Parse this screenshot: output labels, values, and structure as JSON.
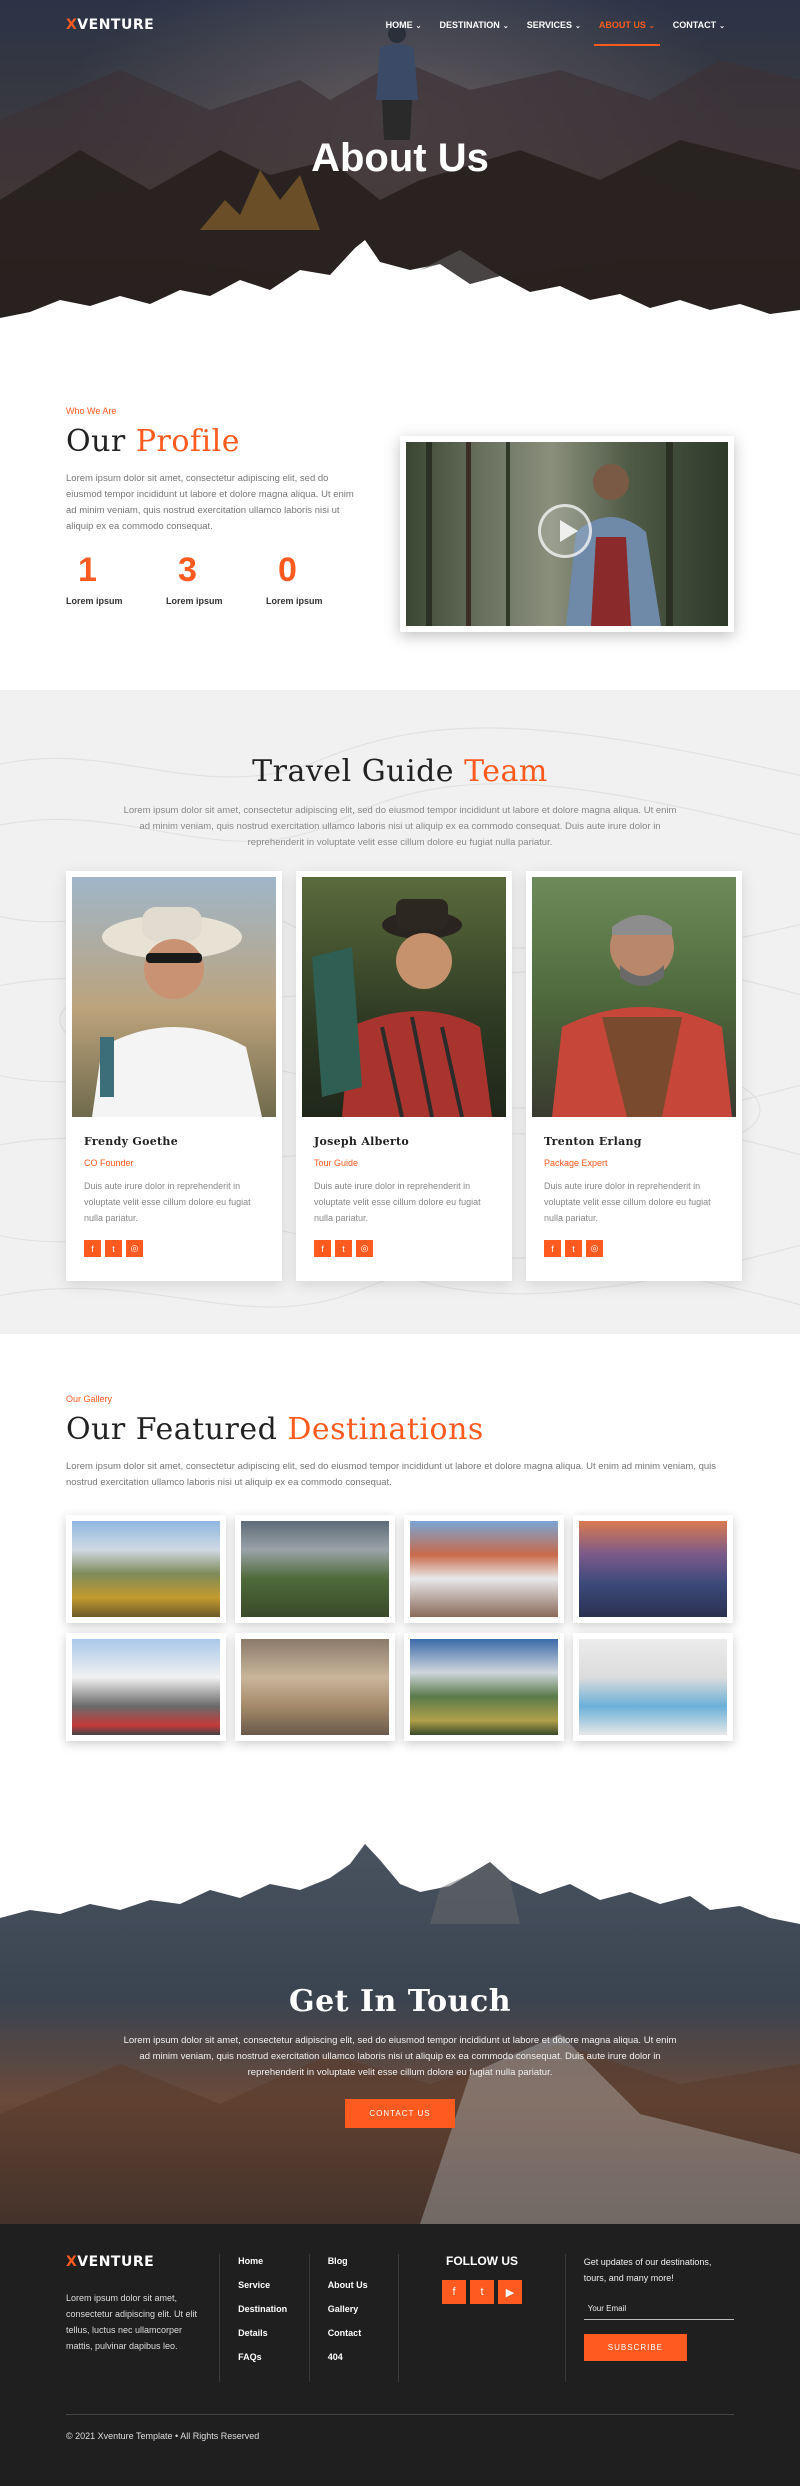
{
  "brand": {
    "logo_x": "X",
    "logo_rest": "VENTURE"
  },
  "nav": {
    "items": [
      {
        "label": "HOME"
      },
      {
        "label": "DESTINATION"
      },
      {
        "label": "SERVICES"
      },
      {
        "label": "ABOUT US",
        "active": true
      },
      {
        "label": "CONTACT"
      }
    ],
    "chevron": "⌄"
  },
  "hero": {
    "title": "About Us"
  },
  "profile": {
    "eyebrow": "Who We Are",
    "title_a": "Our",
    "title_b": "Profile",
    "text": "Lorem ipsum dolor sit amet, consectetur adipiscing elit, sed do eiusmod tempor incididunt ut labore et dolore magna aliqua. Ut enim ad minim veniam, quis nostrud exercitation ullamco laboris nisi ut aliquip ex ea commodo consequat.",
    "counters": [
      {
        "num": "1",
        "label": "Lorem ipsum"
      },
      {
        "num": "3",
        "label": "Lorem ipsum"
      },
      {
        "num": "0",
        "label": "Lorem ipsum"
      }
    ]
  },
  "team": {
    "title_a": "Travel Guide",
    "title_b": "Team",
    "text": "Lorem ipsum dolor sit amet, consectetur adipiscing elit, sed do eiusmod tempor incididunt ut labore et dolore magna aliqua. Ut enim ad minim veniam, quis nostrud exercitation ullamco laboris nisi ut aliquip ex ea commodo consequat. Duis aute irure dolor in reprehenderit in voluptate velit esse cillum dolore eu fugiat nulla pariatur.",
    "members": [
      {
        "name": "Frendy Goethe",
        "role": "CO Founder",
        "desc": "Duis aute irure dolor in reprehenderit in voluptate velit esse cillum dolore eu fugiat nulla pariatur."
      },
      {
        "name": "Joseph Alberto",
        "role": "Tour Guide",
        "desc": "Duis aute irure dolor in reprehenderit in voluptate velit esse cillum dolore eu fugiat nulla pariatur."
      },
      {
        "name": "Trenton Erlang",
        "role": "Package Expert",
        "desc": "Duis aute irure dolor in reprehenderit in voluptate velit esse cillum dolore eu fugiat nulla pariatur."
      }
    ]
  },
  "gallery": {
    "eyebrow": "Our Gallery",
    "title_a": "Our Featured",
    "title_b": "Destinations",
    "text": "Lorem ipsum dolor sit amet, consectetur adipiscing elit, sed do eiusmod tempor incididunt ut labore et dolore magna aliqua. Ut enim ad minim veniam, quis nostrud exercitation ullamco laboris nisi ut aliquip ex ea commodo consequat."
  },
  "cta": {
    "title": "Get In Touch",
    "text": "Lorem ipsum dolor sit amet, consectetur adipiscing elit, sed do eiusmod tempor incididunt ut labore et dolore magna aliqua. Ut enim ad minim veniam, quis nostrud exercitation ullamco laboris nisi ut aliquip ex ea commodo consequat. Duis aute irure dolor in reprehenderit in voluptate velit esse cillum dolore eu fugiat nulla pariatur.",
    "button": "CONTACT US"
  },
  "footer": {
    "about": "Lorem ipsum dolor sit amet, consectetur adipiscing elit. Ut elit tellus, luctus nec ullamcorper mattis, pulvinar dapibus leo.",
    "links_col1": [
      "Home",
      "Service",
      "Destination",
      "Details",
      "FAQs"
    ],
    "links_col2": [
      "Blog",
      "About Us",
      "Gallery",
      "Contact",
      "404"
    ],
    "follow_title": "FOLLOW US",
    "news_text": "Get updates of our destinations, tours, and many more!",
    "email_placeholder": "Your Email",
    "subscribe": "SUBSCRIBE",
    "copyright": "© 2021 Xventure Template • All Rights Reserved"
  },
  "icons": {
    "facebook": "f",
    "twitter": "t",
    "youtube": "▶",
    "instagram": "◎"
  },
  "colors": {
    "accent": "#ff5a1f",
    "dark": "#1f1f1f"
  }
}
